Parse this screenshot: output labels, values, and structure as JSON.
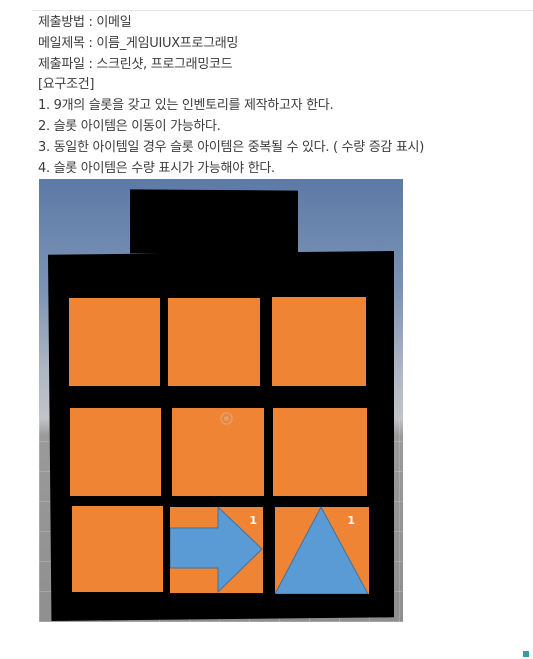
{
  "assignment": {
    "lines": [
      "제출방법 : 이메일",
      "메일제목 : 이름_게임UIUX프로그래밍",
      "제출파일 : 스크린샷, 프로그래밍코드",
      "[요구조건]",
      "1. 9개의 슬롯을 갖고 있는 인벤토리를 제작하고자 한다.",
      "2. 슬롯 아이템은 이동이 가능하다.",
      "3. 동일한 아이템일 경우 슬롯 아이템은 중복될 수 있다. ( 수량 증감 표시)",
      "4. 슬롯 아이템은 수량 표시가 가능해야 한다."
    ]
  },
  "inventory": {
    "slots": [
      {
        "item": null,
        "count": null
      },
      {
        "item": null,
        "count": null
      },
      {
        "item": null,
        "count": null
      },
      {
        "item": null,
        "count": null
      },
      {
        "item": null,
        "count": null
      },
      {
        "item": null,
        "count": null
      },
      {
        "item": null,
        "count": null
      },
      {
        "item": "arrow-icon",
        "count": "1"
      },
      {
        "item": "triangle-icon",
        "count": "1"
      }
    ]
  },
  "colors": {
    "slot": "#ee8434",
    "item_fill": "#5b9bd5",
    "panel": "#000000"
  }
}
